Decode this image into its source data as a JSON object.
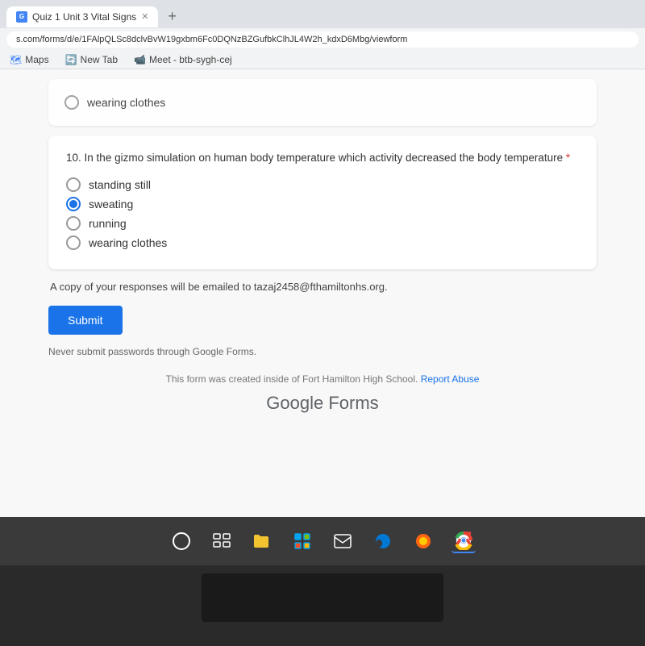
{
  "browser": {
    "tab_title": "Quiz 1 Unit 3 Vital Signs",
    "url": "s.com/forms/d/e/1FAlpQLSc8dclvBvW19gxbm6Fc0DQNzBZGufbkClhJL4W2h_kdxD6Mbg/viewform",
    "bookmarks": [
      {
        "label": "Maps",
        "icon": "maps"
      },
      {
        "label": "New Tab",
        "icon": "newtab"
      },
      {
        "label": "Meet - btb-sygh-cej",
        "icon": "meet"
      }
    ]
  },
  "form": {
    "prev_question": {
      "option_wearing_clothes": "wearing clothes"
    },
    "question10": {
      "number": "10.",
      "text": "In the gizmo simulation on human body temperature which activity decreased the body temperature",
      "required_marker": " *",
      "options": [
        {
          "id": "standing_still",
          "label": "standing still",
          "selected": false
        },
        {
          "id": "sweating",
          "label": "sweating",
          "selected": true
        },
        {
          "id": "running",
          "label": "running",
          "selected": false
        },
        {
          "id": "wearing_clothes",
          "label": "wearing clothes",
          "selected": false
        }
      ]
    },
    "email_notice": "A copy of your responses will be emailed to tazaj2458@fthamiltonhs.org.",
    "submit_label": "Submit",
    "password_warning": "Never submit passwords through Google Forms.",
    "footer": {
      "text": "This form was created inside of Fort Hamilton High School.",
      "report_link": "Report Abuse"
    },
    "google_forms_label": "Google Forms"
  },
  "taskbar": {
    "icons": [
      {
        "name": "search-circle",
        "symbol": "○"
      },
      {
        "name": "windows-tasks",
        "symbol": "⊞"
      },
      {
        "name": "file-explorer",
        "symbol": "📁"
      },
      {
        "name": "store",
        "symbol": "🛍"
      },
      {
        "name": "mail",
        "symbol": "✉"
      },
      {
        "name": "edge-browser",
        "symbol": "edge"
      },
      {
        "name": "firefox",
        "symbol": "ff"
      },
      {
        "name": "chrome",
        "symbol": "ch"
      }
    ]
  }
}
